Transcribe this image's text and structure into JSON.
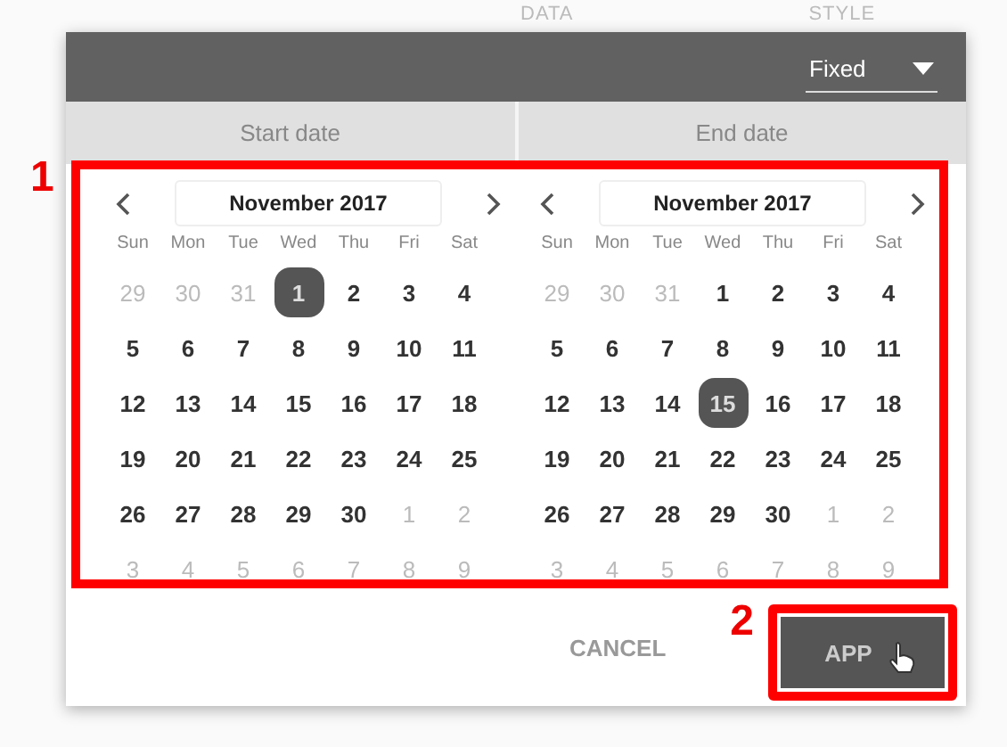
{
  "background_tabs": [
    "DATA",
    "STYLE"
  ],
  "header": {
    "dropdown": {
      "value": "Fixed"
    }
  },
  "columns": [
    "Start date",
    "End date"
  ],
  "annotations": [
    {
      "label": "1"
    },
    {
      "label": "2"
    }
  ],
  "calendars": [
    {
      "month": "November 2017",
      "weekdays": [
        "Sun",
        "Mon",
        "Tue",
        "Wed",
        "Thu",
        "Fri",
        "Sat"
      ],
      "weeks": [
        [
          {
            "day": "29",
            "muted": true,
            "selected": false
          },
          {
            "day": "30",
            "muted": true,
            "selected": false
          },
          {
            "day": "31",
            "muted": true,
            "selected": false
          },
          {
            "day": "1",
            "muted": false,
            "selected": true
          },
          {
            "day": "2",
            "muted": false,
            "selected": false
          },
          {
            "day": "3",
            "muted": false,
            "selected": false
          },
          {
            "day": "4",
            "muted": false,
            "selected": false
          }
        ],
        [
          {
            "day": "5",
            "muted": false,
            "selected": false
          },
          {
            "day": "6",
            "muted": false,
            "selected": false
          },
          {
            "day": "7",
            "muted": false,
            "selected": false
          },
          {
            "day": "8",
            "muted": false,
            "selected": false
          },
          {
            "day": "9",
            "muted": false,
            "selected": false
          },
          {
            "day": "10",
            "muted": false,
            "selected": false
          },
          {
            "day": "11",
            "muted": false,
            "selected": false
          }
        ],
        [
          {
            "day": "12",
            "muted": false,
            "selected": false
          },
          {
            "day": "13",
            "muted": false,
            "selected": false
          },
          {
            "day": "14",
            "muted": false,
            "selected": false
          },
          {
            "day": "15",
            "muted": false,
            "selected": false
          },
          {
            "day": "16",
            "muted": false,
            "selected": false
          },
          {
            "day": "17",
            "muted": false,
            "selected": false
          },
          {
            "day": "18",
            "muted": false,
            "selected": false
          }
        ],
        [
          {
            "day": "19",
            "muted": false,
            "selected": false
          },
          {
            "day": "20",
            "muted": false,
            "selected": false
          },
          {
            "day": "21",
            "muted": false,
            "selected": false
          },
          {
            "day": "22",
            "muted": false,
            "selected": false
          },
          {
            "day": "23",
            "muted": false,
            "selected": false
          },
          {
            "day": "24",
            "muted": false,
            "selected": false
          },
          {
            "day": "25",
            "muted": false,
            "selected": false
          }
        ],
        [
          {
            "day": "26",
            "muted": false,
            "selected": false
          },
          {
            "day": "27",
            "muted": false,
            "selected": false
          },
          {
            "day": "28",
            "muted": false,
            "selected": false
          },
          {
            "day": "29",
            "muted": false,
            "selected": false
          },
          {
            "day": "30",
            "muted": false,
            "selected": false
          },
          {
            "day": "1",
            "muted": true,
            "selected": false
          },
          {
            "day": "2",
            "muted": true,
            "selected": false
          }
        ],
        [
          {
            "day": "3",
            "muted": true,
            "selected": false
          },
          {
            "day": "4",
            "muted": true,
            "selected": false
          },
          {
            "day": "5",
            "muted": true,
            "selected": false
          },
          {
            "day": "6",
            "muted": true,
            "selected": false
          },
          {
            "day": "7",
            "muted": true,
            "selected": false
          },
          {
            "day": "8",
            "muted": true,
            "selected": false
          },
          {
            "day": "9",
            "muted": true,
            "selected": false
          }
        ]
      ]
    },
    {
      "month": "November 2017",
      "weekdays": [
        "Sun",
        "Mon",
        "Tue",
        "Wed",
        "Thu",
        "Fri",
        "Sat"
      ],
      "weeks": [
        [
          {
            "day": "29",
            "muted": true,
            "selected": false
          },
          {
            "day": "30",
            "muted": true,
            "selected": false
          },
          {
            "day": "31",
            "muted": true,
            "selected": false
          },
          {
            "day": "1",
            "muted": false,
            "selected": false
          },
          {
            "day": "2",
            "muted": false,
            "selected": false
          },
          {
            "day": "3",
            "muted": false,
            "selected": false
          },
          {
            "day": "4",
            "muted": false,
            "selected": false
          }
        ],
        [
          {
            "day": "5",
            "muted": false,
            "selected": false
          },
          {
            "day": "6",
            "muted": false,
            "selected": false
          },
          {
            "day": "7",
            "muted": false,
            "selected": false
          },
          {
            "day": "8",
            "muted": false,
            "selected": false
          },
          {
            "day": "9",
            "muted": false,
            "selected": false
          },
          {
            "day": "10",
            "muted": false,
            "selected": false
          },
          {
            "day": "11",
            "muted": false,
            "selected": false
          }
        ],
        [
          {
            "day": "12",
            "muted": false,
            "selected": false
          },
          {
            "day": "13",
            "muted": false,
            "selected": false
          },
          {
            "day": "14",
            "muted": false,
            "selected": false
          },
          {
            "day": "15",
            "muted": false,
            "selected": true
          },
          {
            "day": "16",
            "muted": false,
            "selected": false
          },
          {
            "day": "17",
            "muted": false,
            "selected": false
          },
          {
            "day": "18",
            "muted": false,
            "selected": false
          }
        ],
        [
          {
            "day": "19",
            "muted": false,
            "selected": false
          },
          {
            "day": "20",
            "muted": false,
            "selected": false
          },
          {
            "day": "21",
            "muted": false,
            "selected": false
          },
          {
            "day": "22",
            "muted": false,
            "selected": false
          },
          {
            "day": "23",
            "muted": false,
            "selected": false
          },
          {
            "day": "24",
            "muted": false,
            "selected": false
          },
          {
            "day": "25",
            "muted": false,
            "selected": false
          }
        ],
        [
          {
            "day": "26",
            "muted": false,
            "selected": false
          },
          {
            "day": "27",
            "muted": false,
            "selected": false
          },
          {
            "day": "28",
            "muted": false,
            "selected": false
          },
          {
            "day": "29",
            "muted": false,
            "selected": false
          },
          {
            "day": "30",
            "muted": false,
            "selected": false
          },
          {
            "day": "1",
            "muted": true,
            "selected": false
          },
          {
            "day": "2",
            "muted": true,
            "selected": false
          }
        ],
        [
          {
            "day": "3",
            "muted": true,
            "selected": false
          },
          {
            "day": "4",
            "muted": true,
            "selected": false
          },
          {
            "day": "5",
            "muted": true,
            "selected": false
          },
          {
            "day": "6",
            "muted": true,
            "selected": false
          },
          {
            "day": "7",
            "muted": true,
            "selected": false
          },
          {
            "day": "8",
            "muted": true,
            "selected": false
          },
          {
            "day": "9",
            "muted": true,
            "selected": false
          }
        ]
      ]
    }
  ],
  "buttons": [
    {
      "kind": "text",
      "label": "CANCEL"
    },
    {
      "kind": "primary",
      "label": "APP"
    }
  ]
}
